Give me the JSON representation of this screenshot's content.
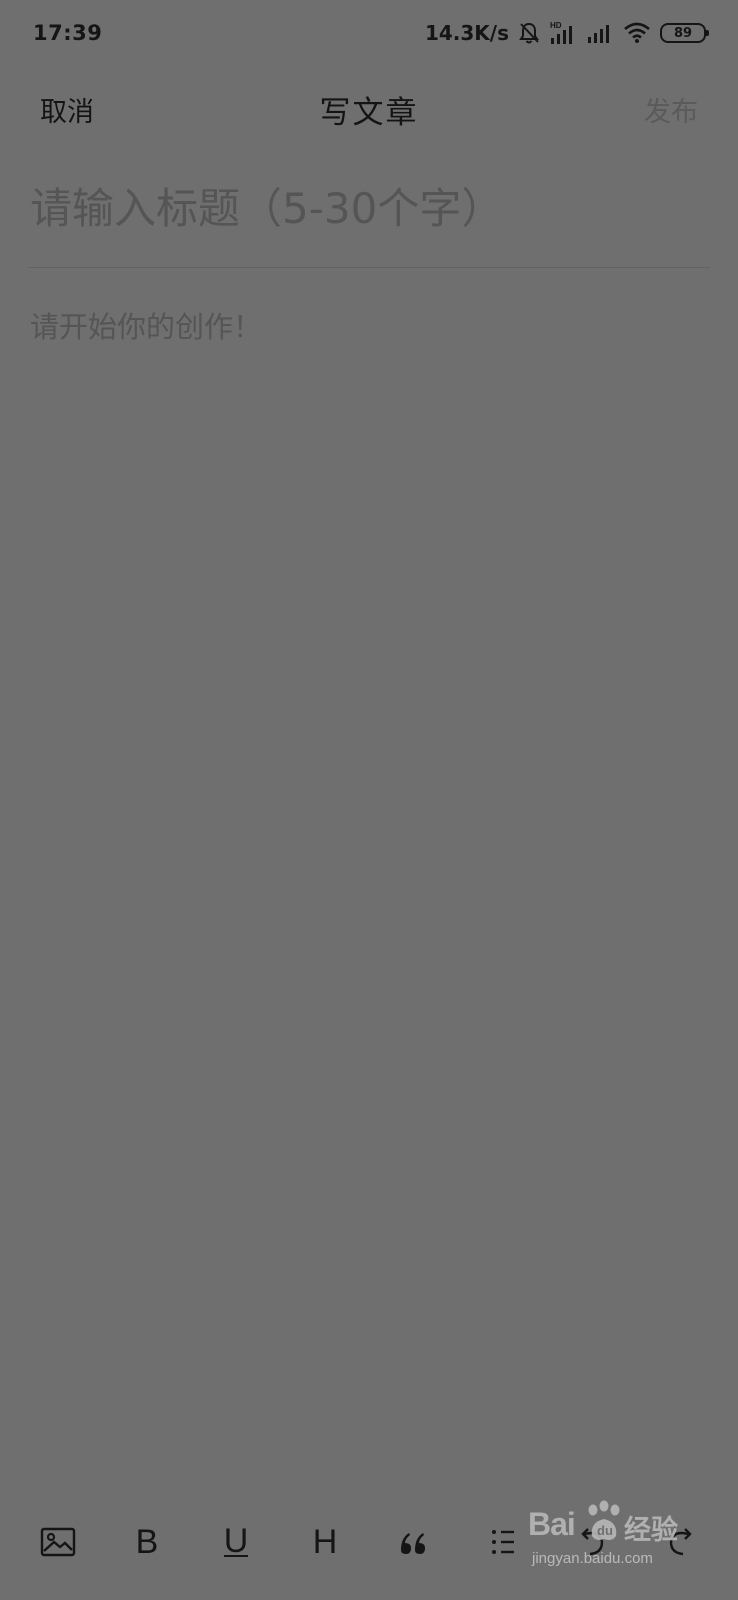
{
  "status_bar": {
    "time": "17:39",
    "network_speed": "14.3K/s",
    "battery_level": "89",
    "icons": [
      "bell-muted-icon",
      "hd-signal-icon",
      "signal-icon",
      "wifi-icon",
      "battery-icon"
    ]
  },
  "nav": {
    "cancel_label": "取消",
    "title": "写文章",
    "publish_label": "发布"
  },
  "editor": {
    "title_placeholder": "请输入标题（5-30个字）",
    "body_placeholder": "请开始你的创作！"
  },
  "toolbar": {
    "items": [
      {
        "icon": "image-icon"
      },
      {
        "icon": "bold-icon",
        "label": "B"
      },
      {
        "icon": "underline-icon",
        "label": "U"
      },
      {
        "icon": "heading-icon",
        "label": "H"
      },
      {
        "icon": "quote-icon"
      },
      {
        "icon": "list-icon"
      },
      {
        "icon": "undo-icon"
      },
      {
        "icon": "redo-icon"
      }
    ]
  },
  "watermark": {
    "brand": "Bai",
    "brand_suffix": "经验",
    "url": "jingyan.baidu.com"
  },
  "colors": {
    "overlay_background": "#6f6f6f",
    "primary_text": "#141414",
    "placeholder_text": "#555555",
    "disabled_text": "#5a5a5a"
  }
}
